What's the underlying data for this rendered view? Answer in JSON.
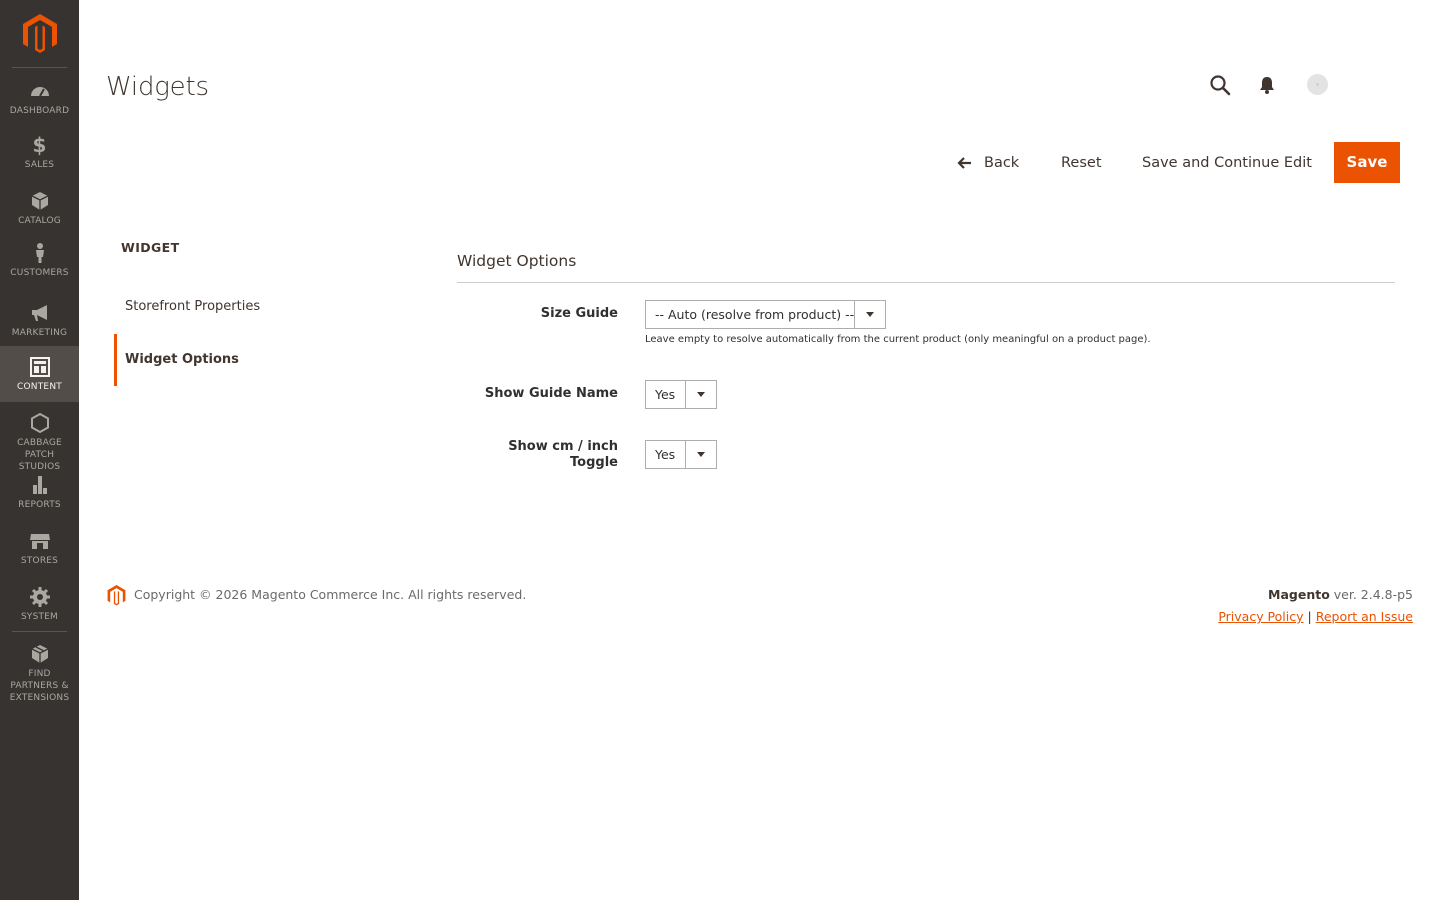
{
  "colors": {
    "accent": "#eb5202",
    "sidebar_bg": "#373330",
    "sidebar_active": "#524d49"
  },
  "sidebar": {
    "items": [
      {
        "label": "DASHBOARD",
        "icon": "dashboard-gauge-icon"
      },
      {
        "label": "SALES",
        "icon": "dollar-icon"
      },
      {
        "label": "CATALOG",
        "icon": "cube-icon"
      },
      {
        "label": "CUSTOMERS",
        "icon": "person-icon"
      },
      {
        "label": "MARKETING",
        "icon": "megaphone-icon"
      },
      {
        "label": "CONTENT",
        "icon": "layout-icon"
      },
      {
        "label": "CABBAGE PATCH STUDIOS",
        "icon": "hexagon-icon"
      },
      {
        "label": "REPORTS",
        "icon": "bar-chart-icon"
      },
      {
        "label": "STORES",
        "icon": "storefront-icon"
      },
      {
        "label": "SYSTEM",
        "icon": "gear-icon"
      },
      {
        "label": "FIND PARTNERS & EXTENSIONS",
        "icon": "box-icon"
      }
    ],
    "active": "CONTENT"
  },
  "header": {
    "title": "Widgets"
  },
  "actions": {
    "back": "Back",
    "reset": "Reset",
    "save_continue": "Save and Continue Edit",
    "save": "Save"
  },
  "tabs": {
    "title": "WIDGET",
    "items": [
      {
        "label": "Storefront Properties"
      },
      {
        "label": "Widget Options"
      }
    ],
    "active": "Widget Options"
  },
  "form": {
    "section_title": "Widget Options",
    "size_guide": {
      "label": "Size Guide",
      "value": "-- Auto (resolve from product) --",
      "note": "Leave empty to resolve automatically from the current product (only meaningful on a product page)."
    },
    "show_guide_name": {
      "label": "Show Guide Name",
      "value": "Yes"
    },
    "show_toggle": {
      "label_line1": "Show cm / inch",
      "label_line2": "Toggle",
      "value": "Yes"
    }
  },
  "footer": {
    "copyright": "Copyright © 2026 Magento Commerce Inc. All rights reserved.",
    "brand": "Magento",
    "version": " ver. 2.4.8-p5",
    "privacy": "Privacy Policy",
    "separator": "|",
    "report": "Report an Issue"
  }
}
